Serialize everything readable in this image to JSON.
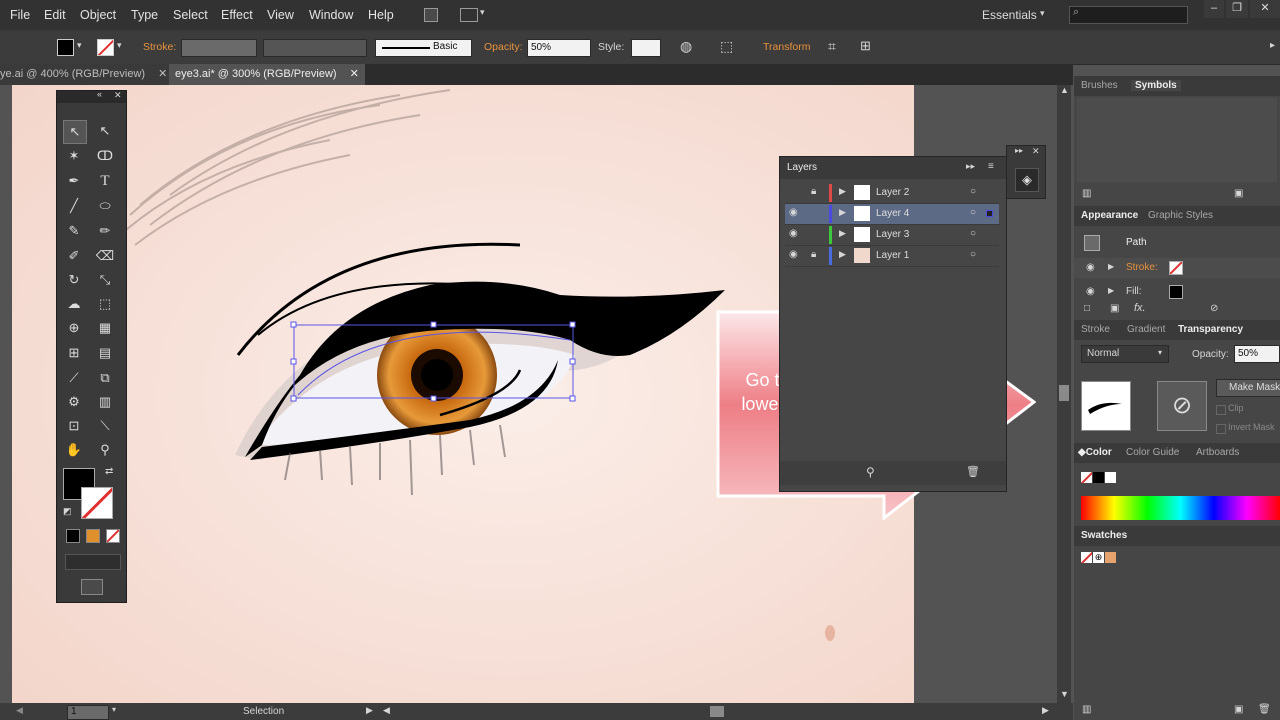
{
  "menu": [
    "File",
    "Edit",
    "Object",
    "Type",
    "Select",
    "Effect",
    "View",
    "Window",
    "Help"
  ],
  "workspace": "Essentials",
  "controlbar": {
    "stroke_label": "Stroke:",
    "brush": "Basic",
    "opacity_label": "Opacity:",
    "opacity_value": "50%",
    "style_label": "Style:",
    "transform_label": "Transform"
  },
  "tabs": [
    "ye.ai @ 400% (RGB/Preview)",
    "eye3.ai* @ 300% (RGB/Preview)"
  ],
  "layers": {
    "title": "Layers",
    "items": [
      {
        "name": "Layer 2",
        "color": "#e04848",
        "locked": true,
        "selected": false
      },
      {
        "name": "Layer 4",
        "color": "#4a4ae0",
        "locked": false,
        "selected": true
      },
      {
        "name": "Layer 3",
        "color": "#3cc83c",
        "locked": false,
        "selected": false
      },
      {
        "name": "Layer 1",
        "color": "#4a6ae0",
        "locked": true,
        "selected": false
      }
    ]
  },
  "dock": {
    "brushes_tab": "Brushes",
    "symbols_tab": "Symbols",
    "appearance_tab": "Appearance",
    "graphic_styles_tab": "Graphic Styles",
    "path_label": "Path",
    "stroke_label": "Stroke:",
    "fill_label": "Fill:",
    "stroke_tab": "Stroke",
    "gradient_tab": "Gradient",
    "transparency_tab": "Transparency",
    "blend_mode": "Normal",
    "opacity_label": "Opacity:",
    "opacity_value": "50%",
    "make_mask": "Make Mask",
    "clip": "Clip",
    "invert_mask": "Invert Mask",
    "color_tab": "Color",
    "color_guide_tab": "Color Guide",
    "artboards_tab": "Artboards",
    "swatches_tab": "Swatches"
  },
  "status": {
    "zoom": "1",
    "tool": "Selection"
  },
  "callout": "Go to Transparency and lower the opacity to 50%."
}
